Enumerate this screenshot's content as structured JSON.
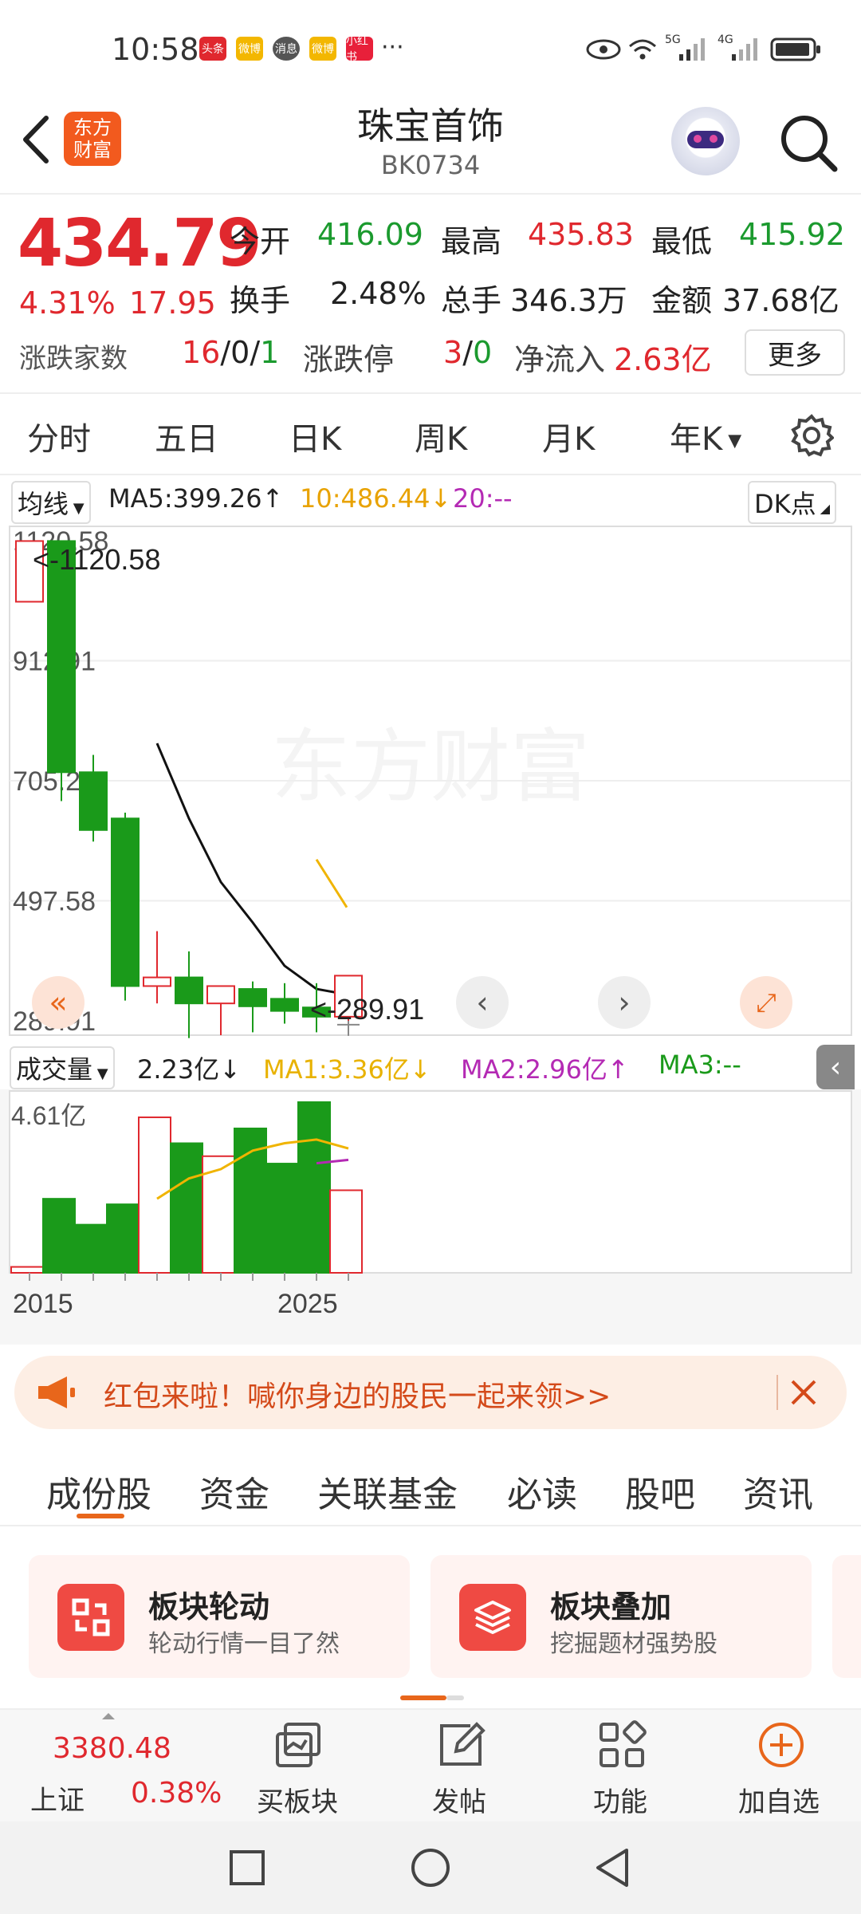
{
  "status_bar": {
    "time": "10:58",
    "apps": [
      "头条",
      "微博",
      "消息",
      "微博",
      "小红书"
    ],
    "more": "···",
    "network_1": "5G",
    "network_2": "4G"
  },
  "header": {
    "logo_line1": "东方",
    "logo_line2": "财富",
    "title": "珠宝首饰",
    "code": "BK0734"
  },
  "quote": {
    "price": "434.79",
    "change_pct": "4.31%",
    "change": "17.95",
    "open_label": "今开",
    "open": "416.09",
    "high_label": "最高",
    "high": "435.83",
    "low_label": "最低",
    "low": "415.92",
    "turnover_label": "换手",
    "turnover": "2.48%",
    "volume_label": "总手",
    "volume": "346.3万",
    "amount_label": "金额",
    "amount": "37.68亿",
    "updown_label": "涨跌家数",
    "up": "16",
    "flat": "0",
    "down": "1",
    "sep": "/",
    "limit_label": "涨跌停",
    "limit_up": "3",
    "limit_down": "0",
    "netflow_label": "净流入",
    "netflow": "2.63亿",
    "more": "更多"
  },
  "chart_tabs": [
    "分时",
    "五日",
    "日K",
    "周K",
    "月K",
    "年K"
  ],
  "active_tab": "年K",
  "ma_bar": {
    "selector": "均线",
    "ma5": "MA5:399.26↑",
    "ma10": "10:486.44↓",
    "ma20": "20:--",
    "dk": "DK点"
  },
  "price_axis": [
    "1120.58",
    "912.91",
    "705.25",
    "497.58",
    "289.91"
  ],
  "max_marker": "<-1120.58",
  "min_marker": "<-289.91",
  "watermark": "东方财富",
  "volume_bar": {
    "selector": "成交量",
    "value": "2.23亿↓",
    "ma1": "MA1:3.36亿↓",
    "ma2": "MA2:2.96亿↑",
    "ma3": "MA3:--",
    "axis_max": "4.61亿"
  },
  "x_axis": [
    "2015",
    "2025"
  ],
  "chart_data": {
    "type": "candlestick",
    "candles": [
      {
        "o": 1015,
        "c": 1120,
        "h": 1120,
        "l": 1015,
        "up": true
      },
      {
        "o": 1120,
        "c": 720,
        "h": 1120,
        "l": 670,
        "up": false
      },
      {
        "o": 720,
        "c": 620,
        "h": 750,
        "l": 600,
        "up": false
      },
      {
        "o": 640,
        "c": 350,
        "h": 650,
        "l": 325,
        "up": false
      },
      {
        "o": 350,
        "c": 365,
        "h": 445,
        "l": 320,
        "up": true
      },
      {
        "o": 365,
        "c": 320,
        "h": 410,
        "l": 260,
        "up": false
      },
      {
        "o": 320,
        "c": 350,
        "h": 350,
        "l": 265,
        "up": true
      },
      {
        "o": 345,
        "c": 315,
        "h": 358,
        "l": 270,
        "up": false
      },
      {
        "o": 328,
        "c": 307,
        "h": 355,
        "l": 285,
        "up": false
      },
      {
        "o": 313,
        "c": 297,
        "h": 355,
        "l": 270,
        "up": false
      },
      {
        "o": 297,
        "c": 368,
        "h": 368,
        "l": 290,
        "up": true
      }
    ],
    "ma5": [
      null,
      null,
      null,
      null,
      770,
      640,
      530,
      460,
      385,
      345,
      335
    ],
    "ma10": [
      null,
      null,
      null,
      null,
      null,
      null,
      null,
      null,
      null,
      null,
      500
    ],
    "volume": [
      0.16,
      2.0,
      1.3,
      1.85,
      4.2,
      3.5,
      3.15,
      3.9,
      2.95,
      4.61,
      2.23
    ],
    "volume_up": [
      true,
      false,
      false,
      false,
      true,
      false,
      true,
      false,
      false,
      false,
      true
    ],
    "vol_ma1": [
      null,
      null,
      null,
      null,
      2.0,
      2.55,
      2.8,
      3.3,
      3.5,
      3.6,
      3.36
    ],
    "vol_ma2": [
      null,
      null,
      null,
      null,
      null,
      null,
      null,
      null,
      null,
      2.96,
      3.05
    ],
    "ymin": 289.91,
    "ymax": 1120.58,
    "vmax": 4.61
  },
  "colors": {
    "up": "#e0282e",
    "down": "#1a9a1a",
    "ma5": "#111111",
    "ma10": "#f0b400",
    "ma2": "#b42ab4",
    "accent": "#e8661b"
  },
  "banner": {
    "text": "红包来啦！喊你身边的股民一起来领>>"
  },
  "bottom_tabs": [
    "成份股",
    "资金",
    "关联基金",
    "必读",
    "股吧",
    "资讯"
  ],
  "cards": [
    {
      "title": "板块轮动",
      "sub": "轮动行情一目了然"
    },
    {
      "title": "板块叠加",
      "sub": "挖掘题材强势股"
    }
  ],
  "bottom_bar": {
    "index_value": "3380.48",
    "index_name": "上证",
    "index_pct": "0.38%",
    "buy_block": "买板块",
    "post": "发帖",
    "functions": "功能",
    "add_fav": "加自选"
  }
}
